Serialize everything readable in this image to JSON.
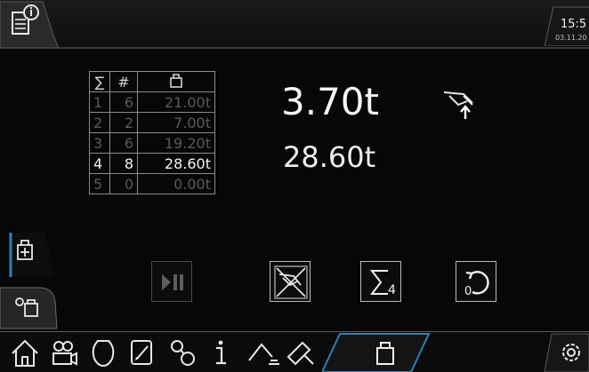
{
  "status": {
    "time": "15:5",
    "date": "03.11.20"
  },
  "table": {
    "header": {
      "sum": "∑",
      "count": "#"
    },
    "rows": [
      {
        "idx": "1",
        "count": "6",
        "load": "21.00t",
        "active": false
      },
      {
        "idx": "2",
        "count": "2",
        "load": "7.00t",
        "active": false
      },
      {
        "idx": "3",
        "count": "6",
        "load": "19.20t",
        "active": false
      },
      {
        "idx": "4",
        "count": "8",
        "load": "28.60t",
        "active": true
      },
      {
        "idx": "5",
        "count": "0",
        "load": "0.00t",
        "active": false
      }
    ]
  },
  "readout": {
    "current_load": "3.70t",
    "total_load": "28.60t"
  },
  "buttons": {
    "sum_button_sub": "4",
    "reset_button_sub": "0"
  },
  "icons": {
    "top": "info-document-icon",
    "hook": "hook-load-icon",
    "side": [
      "add-weight-icon",
      "tare-weight-icon"
    ],
    "actions": [
      "play-pause-icon",
      "cancel-hook-icon",
      "sum-icon",
      "reset-icon"
    ],
    "nav": [
      "home-icon",
      "camera-icon",
      "bucket-icon",
      "edit-icon",
      "gears-icon",
      "info-icon",
      "boom-icon",
      "hammer-icon",
      "weight-icon",
      "settings-icon"
    ]
  },
  "colors": {
    "accent": "#2f7fb3",
    "background": "#070707",
    "text": "#f2f2f2"
  }
}
